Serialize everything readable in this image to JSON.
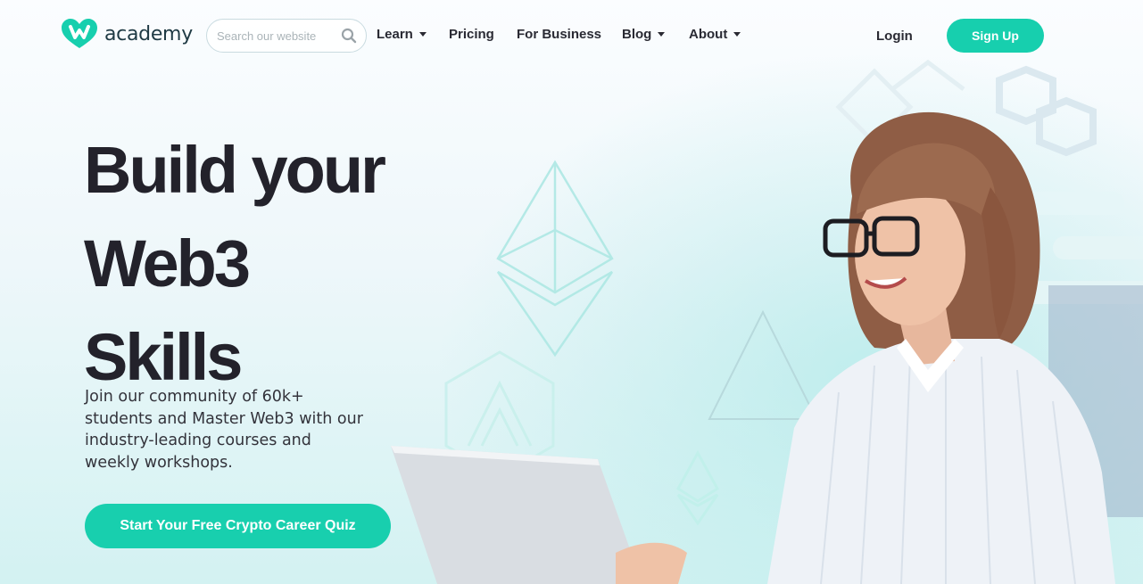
{
  "brand": {
    "name": "academy",
    "color": "#17cfae"
  },
  "search": {
    "placeholder": "Search our website",
    "icon": "search-icon"
  },
  "nav": {
    "items": [
      {
        "label": "Learn",
        "dropdown": true
      },
      {
        "label": "Pricing",
        "dropdown": false
      },
      {
        "label": "For Business",
        "dropdown": false
      },
      {
        "label": "Blog",
        "dropdown": true
      },
      {
        "label": "About",
        "dropdown": true
      }
    ],
    "login_label": "Login",
    "signup_label": "Sign Up"
  },
  "hero": {
    "title_lines": [
      "Build your",
      "Web3",
      "Skills"
    ],
    "subtitle": "Join our community of 60k+ students and Master Web3 with our industry-leading courses and weekly workshops.",
    "cta_label": "Start Your Free Crypto Career Quiz"
  },
  "colors": {
    "accent": "#17cfae",
    "text": "#23222b",
    "background": "#eef7fa"
  }
}
